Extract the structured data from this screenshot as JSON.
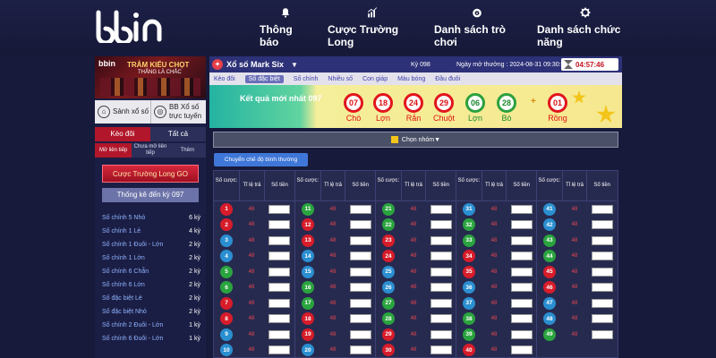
{
  "nav": {
    "logo": "bbin",
    "items": [
      {
        "label": "Thông báo",
        "icon": "bell-icon"
      },
      {
        "label": "Cược Trường Long",
        "icon": "bar-chart-icon"
      },
      {
        "label": "Danh sách trò chơi",
        "icon": "ball-icon"
      },
      {
        "label": "Danh sách chức năng",
        "icon": "gear-icon"
      }
    ]
  },
  "left": {
    "promo": {
      "logo": "bbin",
      "title": "TRẢM KIỂU CHỌT",
      "subtitle": "THẮNG LÀ CHẮC"
    },
    "lobby": [
      {
        "label": "Sảnh xổ số"
      },
      {
        "label": "BB Xổ số trực tuyến"
      }
    ],
    "tabs": [
      "Kèo đôi",
      "Tất cả"
    ],
    "subtabs": [
      "Mở liên tiếp",
      "Chưa mở liên tiếp",
      "Thêm"
    ],
    "long_button": "Cược Trường Long GO",
    "stats_button": "Thống kê đến kỳ 097",
    "stats": [
      {
        "label": "Số chính 5 Nhỏ",
        "count": "6 kỳ"
      },
      {
        "label": "Số chính 1 Lẻ",
        "count": "4 kỳ"
      },
      {
        "label": "Số chính 1 Đuôi - Lớn",
        "count": "2 kỳ"
      },
      {
        "label": "Số chính 1 Lớn",
        "count": "2 kỳ"
      },
      {
        "label": "Số chính 6 Chẵn",
        "count": "2 kỳ"
      },
      {
        "label": "Số chính 6 Lớn",
        "count": "2 kỳ"
      },
      {
        "label": "Số đặc biệt Lẻ",
        "count": "2 kỳ"
      },
      {
        "label": "Số đặc biệt Nhỏ",
        "count": "2 kỳ"
      },
      {
        "label": "Số chính 2 Đuôi - Lớn",
        "count": "1 kỳ"
      },
      {
        "label": "Số chính 6 Đuôi - Lớn",
        "count": "1 kỳ"
      }
    ]
  },
  "game": {
    "title": "Xổ số Mark Six",
    "period": "Kỳ 098",
    "open_label": "Ngày mở thưởng : 2024-08-31 09:30:00",
    "timer": "04:57:46",
    "subtabs": [
      "Kèo đôi",
      "Số đặc biệt",
      "Số chính",
      "Nhiều số",
      "Con giáp",
      "Màu bóng",
      "Đầu đuôi"
    ],
    "active_subtab": "Số đặc biệt",
    "result_label": "Kết quả mới nhất 097",
    "results": [
      {
        "num": "07",
        "zodiac": "Chó",
        "color": "red"
      },
      {
        "num": "18",
        "zodiac": "Lợn",
        "color": "red"
      },
      {
        "num": "24",
        "zodiac": "Rắn",
        "color": "red"
      },
      {
        "num": "29",
        "zodiac": "Chuột",
        "color": "red"
      },
      {
        "num": "06",
        "zodiac": "Lợn",
        "color": "green"
      },
      {
        "num": "28",
        "zodiac": "Bò",
        "color": "green"
      }
    ],
    "plus": "+",
    "special": {
      "num": "01",
      "zodiac": "Rồng",
      "color": "red"
    },
    "group_select": "Chọn nhóm",
    "switch_mode": "Chuyển chế độ bình thường",
    "table_headers": {
      "number": "Số cược:",
      "odds": "Tỉ lệ trả",
      "amount": "Số tiền"
    },
    "odds_value": "48",
    "columns": [
      [
        {
          "n": "1",
          "c": "red"
        },
        {
          "n": "2",
          "c": "red"
        },
        {
          "n": "3",
          "c": "blue"
        },
        {
          "n": "4",
          "c": "blue"
        },
        {
          "n": "5",
          "c": "green"
        },
        {
          "n": "6",
          "c": "green"
        },
        {
          "n": "7",
          "c": "red"
        },
        {
          "n": "8",
          "c": "red"
        },
        {
          "n": "9",
          "c": "blue"
        },
        {
          "n": "10",
          "c": "blue"
        }
      ],
      [
        {
          "n": "11",
          "c": "green"
        },
        {
          "n": "12",
          "c": "red"
        },
        {
          "n": "13",
          "c": "red"
        },
        {
          "n": "14",
          "c": "blue"
        },
        {
          "n": "15",
          "c": "blue"
        },
        {
          "n": "16",
          "c": "green"
        },
        {
          "n": "17",
          "c": "green"
        },
        {
          "n": "18",
          "c": "red"
        },
        {
          "n": "19",
          "c": "red"
        },
        {
          "n": "20",
          "c": "blue"
        }
      ],
      [
        {
          "n": "21",
          "c": "green"
        },
        {
          "n": "22",
          "c": "green"
        },
        {
          "n": "23",
          "c": "red"
        },
        {
          "n": "24",
          "c": "red"
        },
        {
          "n": "25",
          "c": "blue"
        },
        {
          "n": "26",
          "c": "blue"
        },
        {
          "n": "27",
          "c": "green"
        },
        {
          "n": "28",
          "c": "green"
        },
        {
          "n": "29",
          "c": "red"
        },
        {
          "n": "30",
          "c": "red"
        }
      ],
      [
        {
          "n": "31",
          "c": "blue"
        },
        {
          "n": "32",
          "c": "green"
        },
        {
          "n": "33",
          "c": "green"
        },
        {
          "n": "34",
          "c": "red"
        },
        {
          "n": "35",
          "c": "red"
        },
        {
          "n": "36",
          "c": "blue"
        },
        {
          "n": "37",
          "c": "blue"
        },
        {
          "n": "38",
          "c": "green"
        },
        {
          "n": "39",
          "c": "green"
        },
        {
          "n": "40",
          "c": "red"
        }
      ],
      [
        {
          "n": "41",
          "c": "blue"
        },
        {
          "n": "42",
          "c": "blue"
        },
        {
          "n": "43",
          "c": "green"
        },
        {
          "n": "44",
          "c": "green"
        },
        {
          "n": "45",
          "c": "red"
        },
        {
          "n": "46",
          "c": "red"
        },
        {
          "n": "47",
          "c": "blue"
        },
        {
          "n": "48",
          "c": "blue"
        },
        {
          "n": "49",
          "c": "green"
        }
      ]
    ]
  },
  "colors": {
    "red": "#d71c2a",
    "blue": "#2a8fd0",
    "green": "#2aa43e",
    "nav_bg": "#171a3a",
    "accent": "#b2162a"
  }
}
